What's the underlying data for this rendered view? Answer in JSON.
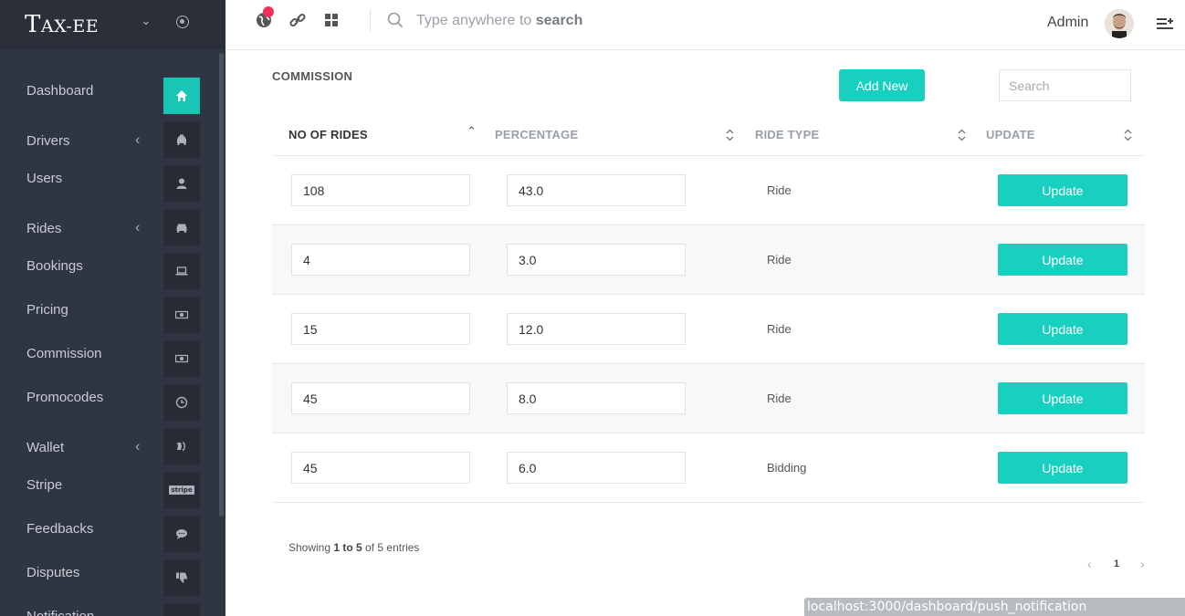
{
  "brand": {
    "big": "T",
    "rest": "AX-EE"
  },
  "sidebar": {
    "items": [
      {
        "label": "Dashboard",
        "icon": "home-icon",
        "active": true,
        "has_arrow": false
      },
      {
        "label": "Drivers",
        "icon": "taxi-icon",
        "active": false,
        "has_arrow": true
      },
      {
        "label": "Users",
        "icon": "user-icon",
        "active": false,
        "has_arrow": false
      },
      {
        "label": "Rides",
        "icon": "car-icon",
        "active": false,
        "has_arrow": true
      },
      {
        "label": "Bookings",
        "icon": "laptop-icon",
        "active": false,
        "has_arrow": false
      },
      {
        "label": "Pricing",
        "icon": "money-icon",
        "active": false,
        "has_arrow": false
      },
      {
        "label": "Commission",
        "icon": "money-icon",
        "active": false,
        "has_arrow": false
      },
      {
        "label": "Promocodes",
        "icon": "clock-icon",
        "active": false,
        "has_arrow": false
      },
      {
        "label": "Wallet",
        "icon": "wallet-icon",
        "active": false,
        "has_arrow": true
      },
      {
        "label": "Stripe",
        "icon": "stripe-icon",
        "active": false,
        "has_arrow": false
      },
      {
        "label": "Feedbacks",
        "icon": "comment-icon",
        "active": false,
        "has_arrow": false
      },
      {
        "label": "Disputes",
        "icon": "thumbs-down-icon",
        "active": false,
        "has_arrow": false
      },
      {
        "label": "Notification",
        "icon": "bell-icon",
        "active": false,
        "has_arrow": false
      }
    ],
    "stripe_icon_text": "stripe"
  },
  "topbar": {
    "search_text": "Type anywhere to ",
    "search_bold": "search",
    "admin_name": "Admin"
  },
  "page": {
    "title": "COMMISSION",
    "add_new": "Add New",
    "search_placeholder": "Search"
  },
  "table": {
    "columns": [
      "NO OF RIDES",
      "PERCENTAGE",
      "RIDE TYPE",
      "UPDATE"
    ],
    "rows": [
      {
        "rides": "108",
        "percentage": "43.0",
        "type": "Ride",
        "button": "Update"
      },
      {
        "rides": "4",
        "percentage": "3.0",
        "type": "Ride",
        "button": "Update"
      },
      {
        "rides": "15",
        "percentage": "12.0",
        "type": "Ride",
        "button": "Update"
      },
      {
        "rides": "45",
        "percentage": "8.0",
        "type": "Ride",
        "button": "Update"
      },
      {
        "rides": "45",
        "percentage": "6.0",
        "type": "Bidding",
        "button": "Update"
      }
    ]
  },
  "footer": {
    "showing_prefix": "Showing ",
    "showing_range": "1 to 5",
    "showing_suffix": " of 5 entries",
    "page": "1",
    "prev": "‹",
    "next": "›"
  },
  "status_url": "localhost:3000/dashboard/push_notification",
  "colors": {
    "accent": "#19cfc0",
    "sidebar": "#2f3542",
    "badge": "#f0325a"
  }
}
